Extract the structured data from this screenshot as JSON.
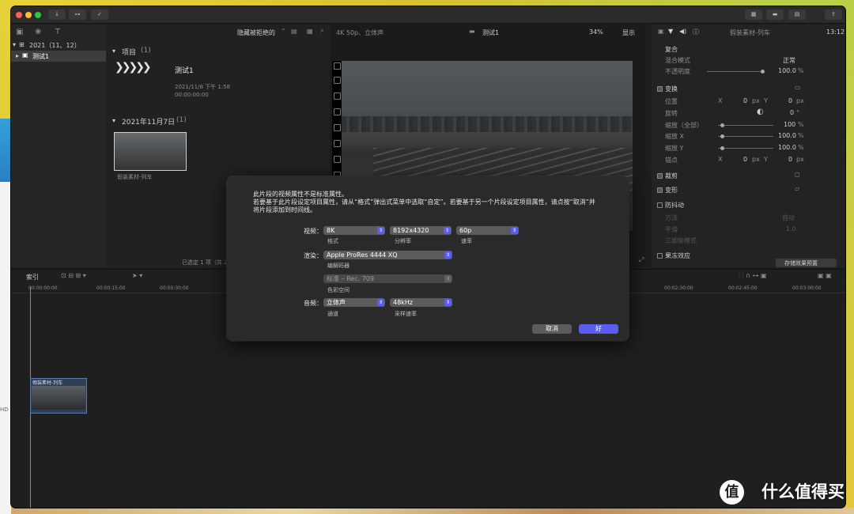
{
  "browser": {
    "filter_label": "隐藏被拒绝的",
    "library_name": "2021（11、12）",
    "event_name": "测试1",
    "projects_header": "项目",
    "projects_count": "(1)",
    "project_name": "测试1",
    "project_date": "2021/11/8 下午 1:58",
    "project_duration": "00:00:00:00",
    "date_group_header": "2021年11月7日",
    "date_group_count": "(1)",
    "clip_name": "假装素材-列车",
    "status_text": "已选定 1 项（共 2"
  },
  "viewer": {
    "format_label": "4K 50p、立体声",
    "title": "测试1",
    "zoom": "34%",
    "view_menu": "显示"
  },
  "inspector": {
    "clip_title": "假装素材-列车",
    "timecode": "13:12",
    "compositing_header": "复合",
    "blend_mode_label": "混合模式",
    "blend_mode_value": "正常",
    "opacity_label": "不透明度",
    "opacity_value": "100.0",
    "percent": "%",
    "transform_header": "变换",
    "position_label": "位置",
    "x_label": "X",
    "y_label": "Y",
    "zero": "0",
    "px": "px",
    "rotation_label": "旋转",
    "degree": "°",
    "scale_all_label": "缩放（全部）",
    "scale_all_value": "100",
    "scale_x_label": "缩放 X",
    "scale_x_value": "100.0",
    "scale_y_label": "缩放 Y",
    "scale_y_value": "100.0",
    "anchor_label": "锚点",
    "crop_header": "裁剪",
    "distort_header": "变形",
    "stabilization_header": "防抖动",
    "stab_row1_label": "方法",
    "stab_row1_value": "自动",
    "stab_row2_label": "平滑",
    "stab_row2_value": "1.0",
    "stab_row3_label": "三脚架模式",
    "rolling_shutter_header": "果冻效应",
    "save_preset_button": "存储效果预置"
  },
  "timeline": {
    "index_tab": "索引",
    "ruler_ticks": [
      "00:00:00:00",
      "00:00:15:00",
      "00:00:30:00",
      "00:02:30:00",
      "00:02:45:00",
      "00:03:00:00"
    ],
    "clip_name": "假装素材-列车",
    "hd_badge": "HD"
  },
  "dialog": {
    "message_line1": "此片段的视频属性不是标准属性。",
    "message_line2": "若要基于此片段设定项目属性，请从“格式”弹出式菜单中选取“自定”。若要基于另一个片段设定项目属性，请点按“取消”并",
    "message_line3": "将片段添加到时间线。",
    "video_label": "视频：",
    "format_value": "8K",
    "format_caption": "格式",
    "resolution_value": "8192x4320",
    "resolution_caption": "分辨率",
    "rate_value": "60p",
    "rate_caption": "速率",
    "render_label": "渲染：",
    "codec_value": "Apple ProRes 4444 XQ",
    "codec_caption": "编解码器",
    "colorspace_value": "标准 – Rec. 709",
    "colorspace_caption": "色彩空间",
    "audio_label": "音频：",
    "channels_value": "立体声",
    "channels_caption": "通道",
    "samplerate_value": "48kHz",
    "samplerate_caption": "采样速率",
    "cancel_button": "取消",
    "ok_button": "好"
  },
  "watermark": {
    "logo_glyph": "值",
    "text": "什么值得买"
  },
  "colors": {
    "accent": "#5a5df0",
    "window_bg": "#1e1e1e",
    "dialog_bg": "#2a2a2a"
  }
}
